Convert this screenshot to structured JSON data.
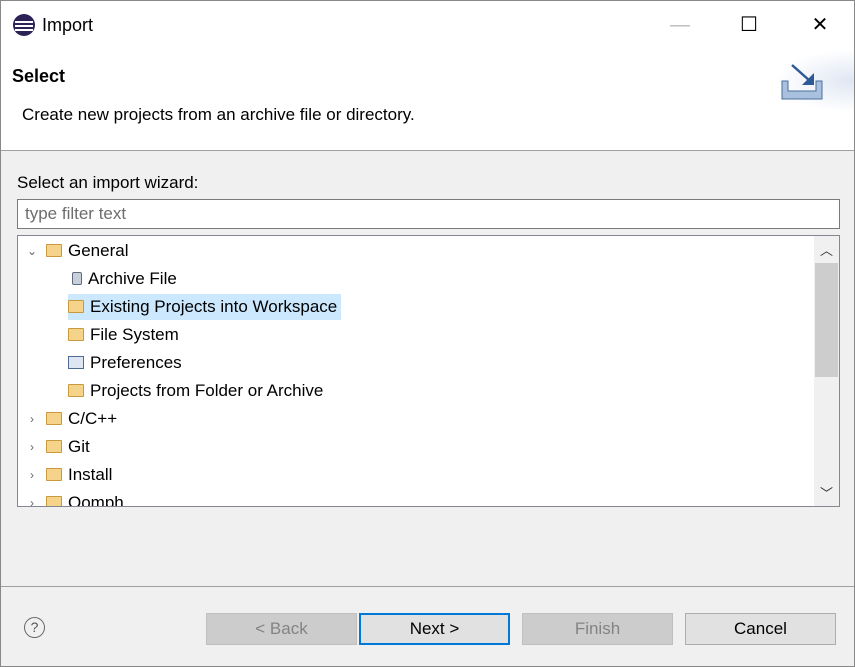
{
  "window": {
    "title": "Import",
    "minimize": "—",
    "maximize": "☐",
    "close": "✕"
  },
  "header": {
    "title": "Select",
    "description": "Create new projects from an archive file or directory."
  },
  "wizard": {
    "label": "Select an import wizard:",
    "filter_placeholder": "type filter text",
    "filter_value": ""
  },
  "tree": {
    "items": [
      {
        "label": "General",
        "level": 0,
        "expanded": true,
        "icon": "folder-open-icon"
      },
      {
        "label": "Archive File",
        "level": 1,
        "icon": "archive-file-icon"
      },
      {
        "label": "Existing Projects into Workspace",
        "level": 1,
        "icon": "existing-projects-icon",
        "selected": true
      },
      {
        "label": "File System",
        "level": 1,
        "icon": "folder-icon"
      },
      {
        "label": "Preferences",
        "level": 1,
        "icon": "preferences-icon"
      },
      {
        "label": "Projects from Folder or Archive",
        "level": 1,
        "icon": "folder-icon"
      },
      {
        "label": "C/C++",
        "level": 0,
        "expanded": false,
        "icon": "folder-open-icon"
      },
      {
        "label": "Git",
        "level": 0,
        "expanded": false,
        "icon": "folder-open-icon"
      },
      {
        "label": "Install",
        "level": 0,
        "expanded": false,
        "icon": "folder-open-icon"
      },
      {
        "label": "Oomph",
        "level": 0,
        "expanded": false,
        "icon": "folder-open-icon"
      }
    ]
  },
  "footer": {
    "help": "?",
    "back": "< Back",
    "next": "Next >",
    "finish": "Finish",
    "cancel": "Cancel"
  },
  "colors": {
    "selection": "#cce8ff",
    "default_button_border": "#0078d7"
  }
}
